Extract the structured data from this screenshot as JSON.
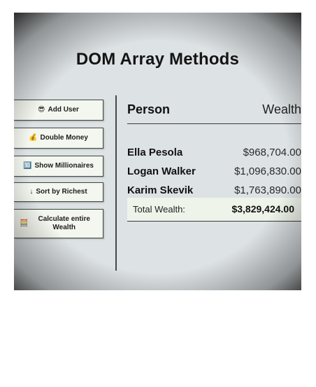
{
  "header": {
    "title": "DOM Array Methods"
  },
  "sidebar": {
    "buttons": [
      {
        "icon": "😎",
        "label": "Add User"
      },
      {
        "icon": "💰",
        "label": "Double Money"
      },
      {
        "icon": "🔟",
        "label": "Show Millionaires"
      },
      {
        "icon": "↓",
        "label": "Sort by Richest"
      },
      {
        "icon": "🧮",
        "label": "Calculate entire Wealth"
      }
    ]
  },
  "table": {
    "headers": {
      "person": "Person",
      "wealth": "Wealth"
    },
    "rows": [
      {
        "name": "Ella Pesola",
        "wealth": "$968,704.00"
      },
      {
        "name": "Logan Walker",
        "wealth": "$1,096,830.00"
      },
      {
        "name": "Karim Skevik",
        "wealth": "$1,763,890.00"
      }
    ],
    "total": {
      "label": "Total Wealth:",
      "value": "$3,829,424.00"
    }
  }
}
